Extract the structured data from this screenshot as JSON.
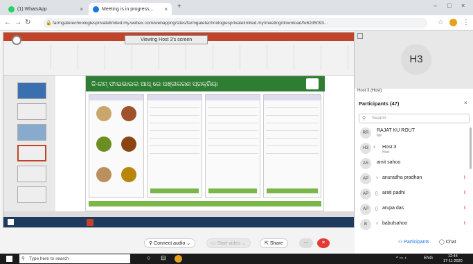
{
  "browser": {
    "tabs": [
      {
        "label": "(1) WhatsApp"
      },
      {
        "label": "Meeting is in progress..."
      }
    ],
    "new_tab": "+",
    "url": "farmgatetechnologiesprivatelimited.my.webex.com/webappng/sites/farmgatetechnologiesprivatelimited.my/meeting/download/fe62d5093..."
  },
  "share": {
    "viewing_label": "Viewing Host 3's screen",
    "slide_title": "ଜି-ନାମ୍ ଫାଇଭାଇଲ ଆପ୍ ରେ ପଞ୍ଜୀକରଣ ପ୍ରକ୍ରିୟା"
  },
  "right_panel": {
    "tile_initials": "H3",
    "tile_label": "Host 3 (Host)",
    "participants_header": "Participants (47)",
    "close": "×",
    "search_placeholder": "Search",
    "participants": [
      {
        "initials": "RR",
        "name": "RAJAT KU ROUT",
        "sub": "Me"
      },
      {
        "initials": "H3",
        "name": "Host 3",
        "sub": "Host"
      },
      {
        "initials": "AS",
        "name": "amit sahoo",
        "sub": ""
      },
      {
        "initials": "AP",
        "name": "anuradha pradhan",
        "sub": ""
      },
      {
        "initials": "AP",
        "name": "arati padhi",
        "sub": ""
      },
      {
        "initials": "AP",
        "name": "arupa das",
        "sub": ""
      },
      {
        "initials": "B",
        "name": "babulsahoo",
        "sub": ""
      }
    ],
    "participants_btn": "Participants",
    "chat_btn": "Chat"
  },
  "controls": {
    "connect_audio": "Connect audio",
    "start_video": "Start video",
    "share": "Share",
    "more": "···",
    "leave": "×"
  },
  "taskbar": {
    "search_placeholder": "Type here to search",
    "time": "12:44",
    "date": "17-11-2020",
    "lang": "ENG"
  },
  "colors": {
    "accent": "#1a73e8",
    "leave": "#e53935",
    "ppt": "#c0432a",
    "slide_header": "#2e7d32"
  }
}
